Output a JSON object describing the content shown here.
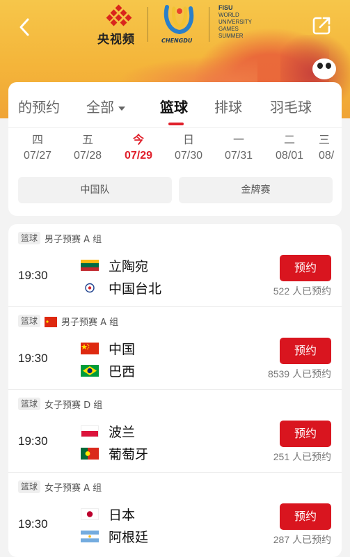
{
  "header": {
    "cctv_logo_text": "央视频",
    "chengdu_logo_text": "CHENGDU",
    "fisu_title": "FISU",
    "fisu_lines": [
      "WORLD",
      "UNIVERSITY",
      "GAMES",
      "SUMMER"
    ]
  },
  "tabs": [
    {
      "label": "的预约"
    },
    {
      "label": "全部"
    },
    {
      "label": "篮球"
    },
    {
      "label": "排球"
    },
    {
      "label": "羽毛球"
    }
  ],
  "active_tab": "篮球",
  "days": [
    {
      "weekday": "四",
      "date": "07/27"
    },
    {
      "weekday": "五",
      "date": "07/28"
    },
    {
      "weekday": "今",
      "date": "07/29"
    },
    {
      "weekday": "日",
      "date": "07/30"
    },
    {
      "weekday": "一",
      "date": "07/31"
    },
    {
      "weekday": "二",
      "date": "08/01"
    },
    {
      "weekday": "三",
      "date": "08/"
    }
  ],
  "filters": [
    "中国队",
    "金牌赛"
  ],
  "matches": [
    {
      "sport": "篮球",
      "round": "男子预赛 A 组",
      "time": "19:30",
      "team1": "立陶宛",
      "team2": "中国台北",
      "button": "预约",
      "count": "522 人已预约"
    },
    {
      "sport": "篮球",
      "round": "男子预赛 A 组",
      "time": "19:30",
      "team1": "中国",
      "team2": "巴西",
      "button": "预约",
      "count": "8539 人已预约"
    },
    {
      "sport": "篮球",
      "round": "女子预赛 D 组",
      "time": "19:30",
      "team1": "波兰",
      "team2": "葡萄牙",
      "button": "预约",
      "count": "251 人已预约"
    },
    {
      "sport": "篮球",
      "round": "女子预赛 A 组",
      "time": "19:30",
      "team1": "日本",
      "team2": "阿根廷",
      "button": "预约",
      "count": "287 人已预约"
    }
  ],
  "colors": {
    "accent": "#e0202b",
    "button": "#d9151f",
    "banner": "#f4b53a"
  },
  "icons": [
    "back-icon",
    "share-icon",
    "chevron-down-icon"
  ]
}
